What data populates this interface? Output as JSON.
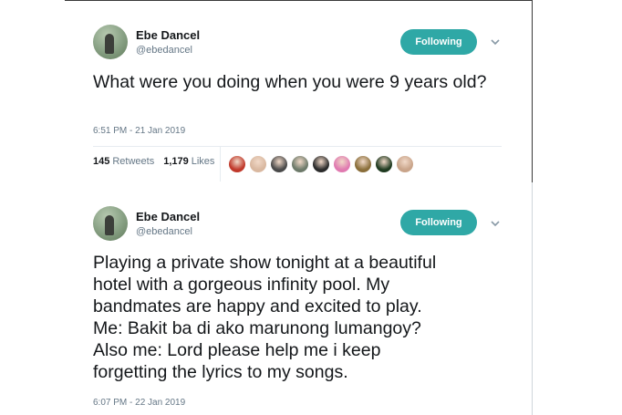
{
  "tweets": [
    {
      "name": "Ebe Dancel",
      "handle": "@ebedancel",
      "follow_label": "Following",
      "text": "What were you doing when you were 9 years old?",
      "timestamp": "6:51 PM - 21 Jan 2019",
      "retweets_count": "145",
      "retweets_label": "Retweets",
      "likes_count": "1,179",
      "likes_label": "Likes",
      "liker_avatars": [
        "#c0392b",
        "#d9b8a0",
        "#4a4a4a",
        "#6d7a6a",
        "#2b2b2b",
        "#e07ab0",
        "#8a6e3a",
        "#1f3a20",
        "#c9a48a"
      ]
    },
    {
      "name": "Ebe Dancel",
      "handle": "@ebedancel",
      "follow_label": "Following",
      "text_lines": [
        "Playing a private show tonight at a beautiful",
        "hotel with a gorgeous infinity pool. My",
        "bandmates are happy and excited to play.",
        "Me: Bakit ba di ako marunong lumangoy?",
        "Also me: Lord please help me i keep",
        "forgetting the lyrics to my songs."
      ],
      "timestamp": "6:07 PM - 22 Jan 2019"
    }
  ],
  "colors": {
    "accent": "#2fa8a6",
    "secondary_text": "#657786"
  },
  "icons": {
    "menu": "chevron-down-icon"
  }
}
